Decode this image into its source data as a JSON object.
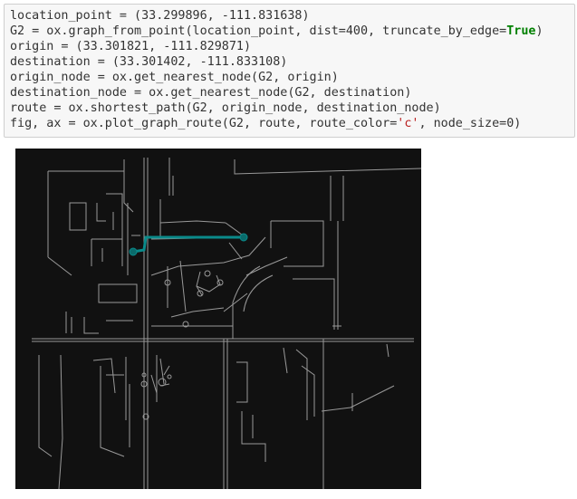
{
  "notebook": {
    "code_lines": [
      {
        "parts": [
          {
            "text": "location_point = (33.299896, -111.831638)",
            "cls": ""
          }
        ]
      },
      {
        "parts": [
          {
            "text": "G2 = ox.graph_from_point(location_point, dist=400, truncate_by_edge=",
            "cls": ""
          },
          {
            "text": "True",
            "cls": "kw"
          },
          {
            "text": ")",
            "cls": ""
          }
        ]
      },
      {
        "parts": [
          {
            "text": "origin = (33.301821, -111.829871)",
            "cls": ""
          }
        ]
      },
      {
        "parts": [
          {
            "text": "destination = (33.301402, -111.833108)",
            "cls": ""
          }
        ]
      },
      {
        "parts": [
          {
            "text": "origin_node = ox.get_nearest_node(G2, origin)",
            "cls": ""
          }
        ]
      },
      {
        "parts": [
          {
            "text": "destination_node = ox.get_nearest_node(G2, destination)",
            "cls": ""
          }
        ]
      },
      {
        "parts": [
          {
            "text": "route = ox.shortest_path(G2, origin_node, destination_node)",
            "cls": ""
          }
        ]
      },
      {
        "parts": [
          {
            "text": "fig, ax = ox.plot_graph_route(G2, route, route_color=",
            "cls": ""
          },
          {
            "text": "'c'",
            "cls": "str"
          },
          {
            "text": ", node_size=0)",
            "cls": ""
          }
        ]
      }
    ]
  },
  "plot": {
    "background_color": "#111111",
    "edge_color": "#999999",
    "route_color": "#0a8a8a"
  }
}
